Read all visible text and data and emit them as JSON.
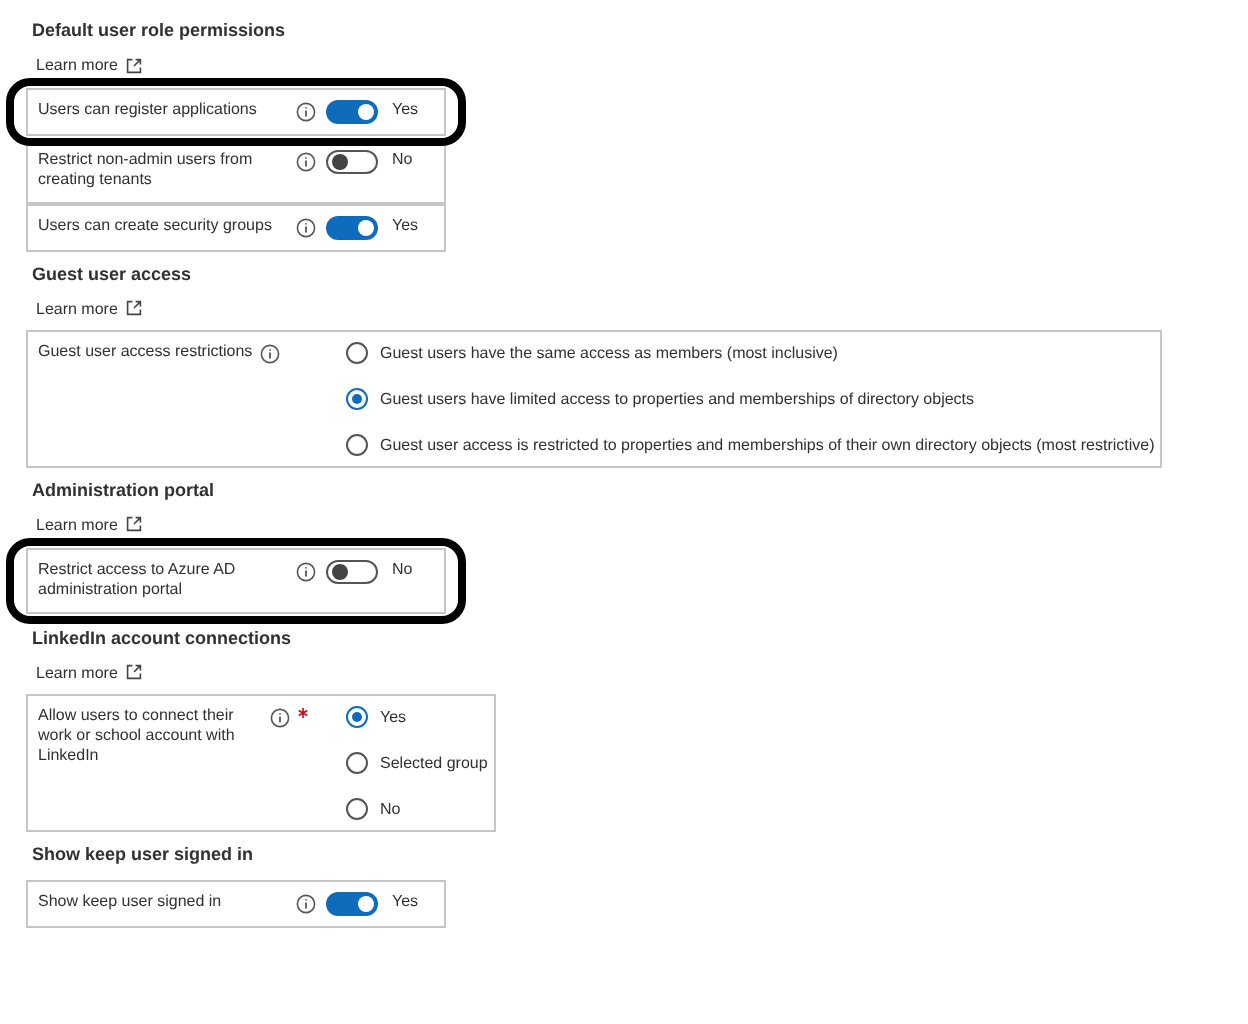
{
  "sections": [
    {
      "title": "Default user role permissions",
      "learn_more": "Learn more",
      "kind": "toggles",
      "rows": [
        {
          "label": "Users can register applications",
          "on": true,
          "value": "Yes",
          "highlighted": true
        },
        {
          "label": "Restrict non-admin users from creating tenants",
          "on": false,
          "value": "No",
          "highlighted": false
        },
        {
          "label": "Users can create security groups",
          "on": true,
          "value": "Yes",
          "highlighted": false
        }
      ]
    },
    {
      "title": "Guest user access",
      "learn_more": "Learn more",
      "kind": "radio",
      "field": {
        "label": "Guest user access restrictions",
        "required": false,
        "options": [
          {
            "label": "Guest users have the same access as members (most inclusive)",
            "selected": false
          },
          {
            "label": "Guest users have limited access to properties and memberships of directory objects",
            "selected": true
          },
          {
            "label": "Guest user access is restricted to properties and memberships of their own directory objects (most restrictive)",
            "selected": false
          }
        ]
      }
    },
    {
      "title": "Administration portal",
      "learn_more": "Learn more",
      "kind": "toggles",
      "rows": [
        {
          "label": "Restrict access to Azure AD administration portal",
          "on": false,
          "value": "No",
          "highlighted": true
        }
      ]
    },
    {
      "title": "LinkedIn account connections",
      "learn_more": "Learn more",
      "kind": "radio",
      "field": {
        "label": "Allow users to connect their work or school account with LinkedIn",
        "required": true,
        "options": [
          {
            "label": "Yes",
            "selected": true
          },
          {
            "label": "Selected group",
            "selected": false
          },
          {
            "label": "No",
            "selected": false
          }
        ]
      }
    },
    {
      "title": "Show keep user signed in",
      "kind": "toggles",
      "rows": [
        {
          "label": "Show keep user signed in",
          "on": true,
          "value": "Yes",
          "highlighted": false
        }
      ]
    }
  ]
}
